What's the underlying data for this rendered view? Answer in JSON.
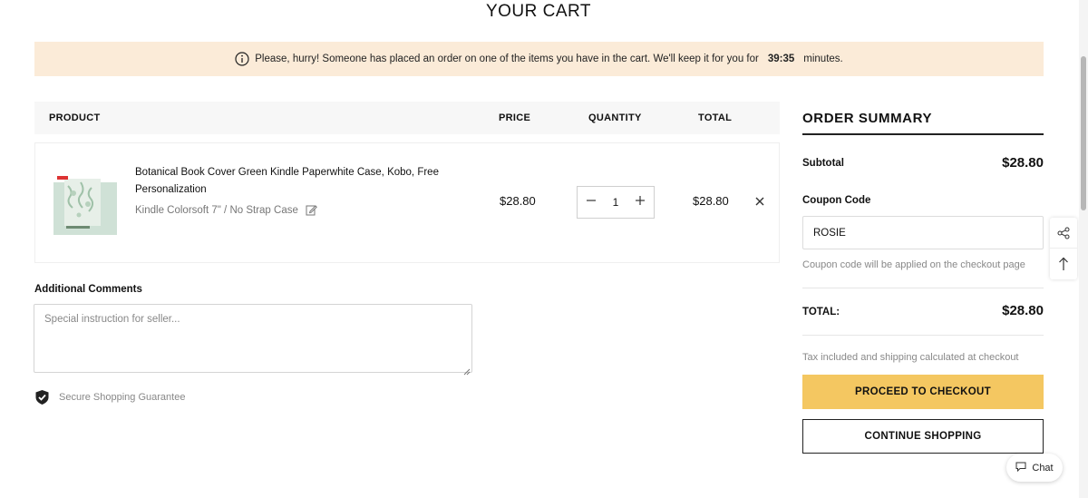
{
  "page": {
    "title": "YOUR CART"
  },
  "banner": {
    "message": "Please, hurry! Someone has placed an order on one of the items you have in the cart. We'll keep it for you for",
    "timer": "39:35",
    "suffix": "minutes."
  },
  "table": {
    "headers": {
      "product": "PRODUCT",
      "price": "PRICE",
      "quantity": "QUANTITY",
      "total": "TOTAL"
    }
  },
  "cart_items": [
    {
      "title": "Botanical Book Cover Green Kindle Paperwhite Case, Kobo, Free Personalization",
      "variant": "Kindle Colorsoft 7\" / No Strap Case",
      "price": "$28.80",
      "quantity": "1",
      "total": "$28.80"
    }
  ],
  "comments": {
    "label": "Additional Comments",
    "placeholder": "Special instruction for seller..."
  },
  "secure": {
    "label": "Secure Shopping Guarantee"
  },
  "summary": {
    "title": "ORDER SUMMARY",
    "subtotal_label": "Subtotal",
    "subtotal_value": "$28.80",
    "coupon_label": "Coupon Code",
    "coupon_value": "ROSIE",
    "coupon_note": "Coupon code will be applied on the checkout page",
    "total_label": "TOTAL:",
    "total_value": "$28.80",
    "tax_note": "Tax included and shipping calculated at checkout",
    "checkout_label": "PROCEED TO CHECKOUT",
    "continue_label": "CONTINUE SHOPPING"
  },
  "chat": {
    "label": "Chat"
  },
  "colors": {
    "banner_bg": "#fbebd8",
    "checkout_bg": "#f4c761",
    "header_bg": "#f7f7f7"
  },
  "icons": [
    "info-icon",
    "edit-icon",
    "close-icon",
    "minus-icon",
    "plus-icon",
    "shield-check-icon",
    "share-icon",
    "arrow-up-icon",
    "chat-icon"
  ]
}
